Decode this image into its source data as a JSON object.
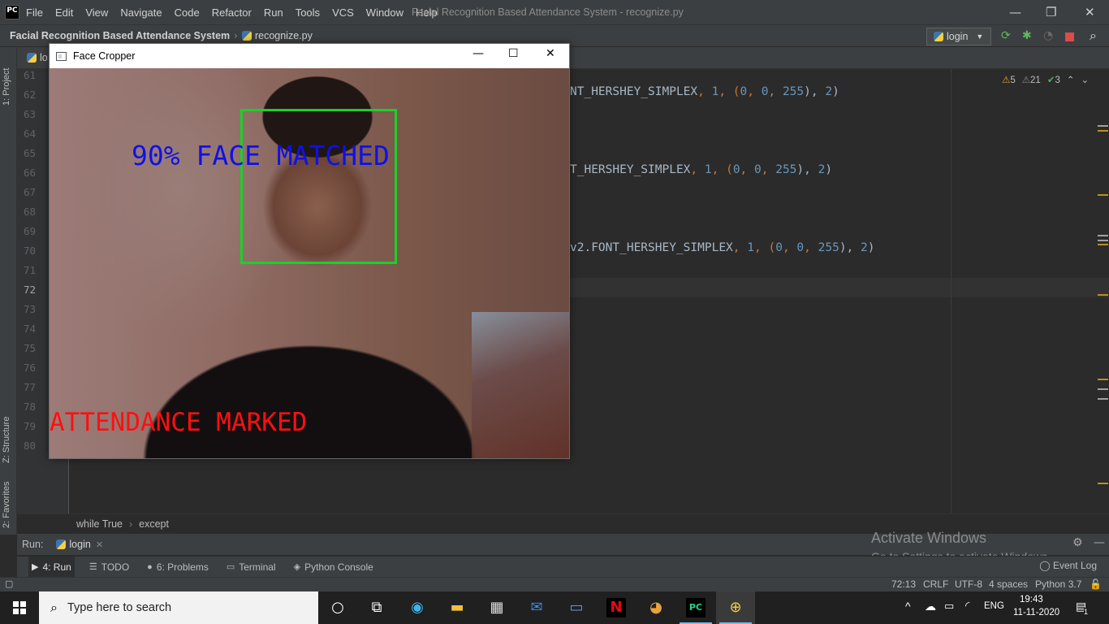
{
  "menubar": {
    "logo": "PC",
    "items": [
      "File",
      "Edit",
      "View",
      "Navigate",
      "Code",
      "Refactor",
      "Run",
      "Tools",
      "VCS",
      "Window",
      "Help"
    ],
    "title": "Facial Recognition Based Attendance System - recognize.py",
    "controls": {
      "minimize": "—",
      "restore": "❐",
      "close": "✕"
    }
  },
  "navbar": {
    "project": "Facial Recognition Based Attendance System",
    "separator": "›",
    "file": "recognize.py",
    "run_config": "login",
    "run_config_chev": "▼"
  },
  "editor": {
    "tab_partial": "lo",
    "line_numbers": [
      "61",
      "62",
      "63",
      "64",
      "65",
      "66",
      "67",
      "68",
      "69",
      "70",
      "71",
      "72",
      "73",
      "74",
      "75",
      "76",
      "77",
      "78",
      "79",
      "80"
    ],
    "current_line": "72",
    "code": [
      {
        "line": 2,
        "text": "NT_HERSHEY_SIMPLEX",
        "rest": [
          ", ",
          "1",
          ", (",
          "0",
          ", ",
          "0",
          ", ",
          "255",
          "), ",
          "2",
          ")"
        ]
      },
      {
        "line": 6,
        "text": "T_HERSHEY_SIMPLEX",
        "rest": [
          ", ",
          "1",
          ", (",
          "0",
          ", ",
          "0",
          ", ",
          "255",
          "), ",
          "2",
          ")"
        ]
      },
      {
        "line": 10,
        "text": "v2.FONT_HERSHEY_SIMPLEX",
        "rest": [
          ", ",
          "1",
          ", (",
          "0",
          ", ",
          "0",
          ", ",
          "255",
          "), ",
          "2",
          ")"
        ]
      }
    ],
    "inspections": {
      "warnings": "5",
      "weak": "21",
      "ok": "3"
    }
  },
  "code_breadcrumb": {
    "items": [
      "while True",
      "except"
    ],
    "separator": "›"
  },
  "run_panel": {
    "label": "Run:",
    "tab": "login",
    "close": "✕"
  },
  "tool_tabs": [
    {
      "icon": "▶",
      "label": "4: Run",
      "active": true
    },
    {
      "icon": "☰",
      "label": "TODO",
      "active": false
    },
    {
      "icon": "●",
      "label": "6: Problems",
      "active": false
    },
    {
      "icon": "▭",
      "label": "Terminal",
      "active": false
    },
    {
      "icon": "◈",
      "label": "Python Console",
      "active": false
    }
  ],
  "event_log": "Event Log",
  "watermark": {
    "line1": "Activate Windows",
    "line2": "Go to Settings to activate Windows."
  },
  "status_bar": {
    "position": "72:13",
    "line_sep": "CRLF",
    "encoding": "UTF-8",
    "indent": "4 spaces",
    "interpreter": "Python 3.7"
  },
  "left_strip": {
    "project": "1: Project",
    "structure": "Z: Structure",
    "favorites": "2: Favorites"
  },
  "face_window": {
    "title": "Face Cropper",
    "controls": {
      "minimize": "—",
      "maximize": "☐",
      "close": "✕"
    },
    "match_text": "90% FACE MATCHED",
    "attendance_text": "ATTENDANCE MARKED",
    "box_color": "#1bd02a",
    "match_color": "#1010e8",
    "attendance_color": "#ff1010"
  },
  "taskbar": {
    "search_placeholder": "Type here to search",
    "language": "ENG",
    "time": "19:43",
    "date": "11-11-2020",
    "notification_count": "1"
  }
}
